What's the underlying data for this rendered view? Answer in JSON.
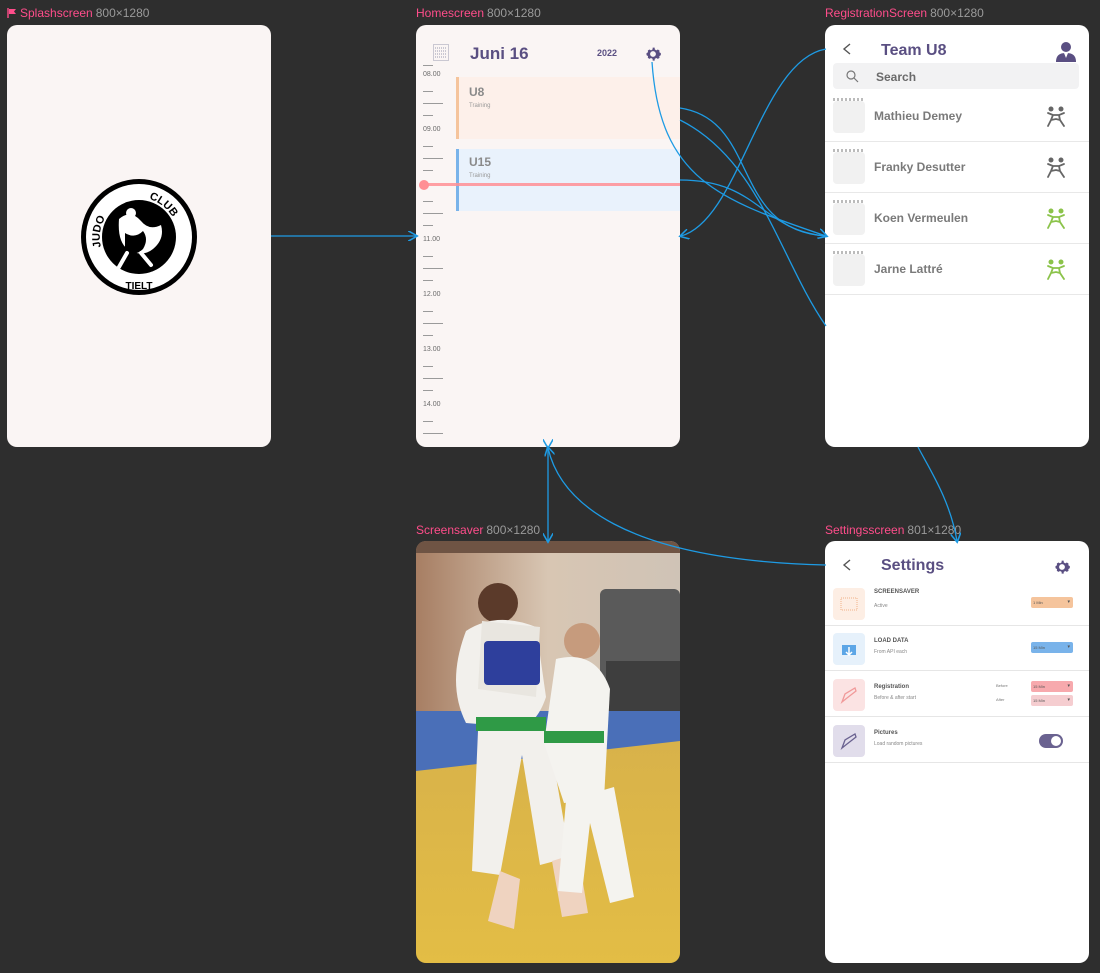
{
  "frames": {
    "splash": {
      "name": "Splashscreen",
      "size": "800×1280"
    },
    "home": {
      "name": "Homescreen",
      "size": "800×1280"
    },
    "registration": {
      "name": "RegistrationScreen",
      "size": "800×1280"
    },
    "screensaver": {
      "name": "Screensaver",
      "size": "800×1280"
    },
    "settings": {
      "name": "Settingsscreen",
      "size": "801×1280"
    }
  },
  "splash": {
    "logo_text": [
      "JUDO",
      "CLUB",
      "TIELT"
    ]
  },
  "home": {
    "title": "Juni  16",
    "year": "2022",
    "times": [
      "08.00",
      "09.00",
      "11.00",
      "12.00",
      "13.00",
      "14.00"
    ],
    "events": [
      {
        "title": "U8",
        "subtitle": "Training",
        "color": "#fdf0ea",
        "bar": "#f5c49c"
      },
      {
        "title": "U15",
        "subtitle": "Training",
        "color": "#e9f2fc",
        "bar": "#79b3ea"
      }
    ]
  },
  "registration": {
    "title": "Team U8",
    "search_placeholder": "Search",
    "members": [
      {
        "name": "Mathieu Demey",
        "status": "absent"
      },
      {
        "name": "Franky Desutter",
        "status": "absent"
      },
      {
        "name": "Koen Vermeulen",
        "status": "present"
      },
      {
        "name": "Jarne Lattré",
        "status": "present"
      }
    ]
  },
  "settings": {
    "title": "Settings",
    "rows": [
      {
        "title": "SCREENSAVER",
        "subtitle": "Active",
        "dropdowns": [
          "1 Min"
        ]
      },
      {
        "title": "LOAD DATA",
        "subtitle": "From API each",
        "dropdowns": [
          "15 Min"
        ]
      },
      {
        "title": "Registration",
        "subtitle": "Before & after start",
        "labels": [
          "Before",
          "After"
        ],
        "dropdowns": [
          "15 Min",
          "15 Min"
        ]
      },
      {
        "title": "Pictures",
        "subtitle": "Load random pictures",
        "toggle": true
      }
    ]
  },
  "colors": {
    "accent": "#5a4f82",
    "link": "#1e9be4",
    "label": "#ff4d8b",
    "absent": "#666666",
    "present": "#8bc34a"
  }
}
